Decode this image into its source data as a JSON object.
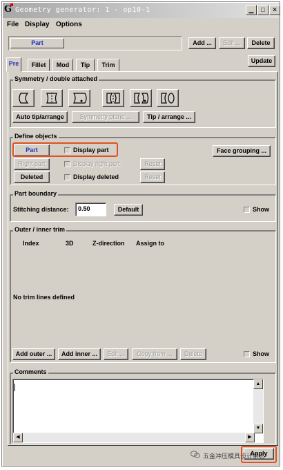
{
  "window": {
    "title": "Geometry generator: 1  -  op10-1"
  },
  "menubar": [
    "File",
    "Display",
    "Options"
  ],
  "part_bar": {
    "part_label": "Part",
    "add_label": "Add ...",
    "edit_label": "Edit ...",
    "delete_label": "Delete"
  },
  "tabs": [
    "Pre",
    "Fillet",
    "Mod",
    "Tip",
    "Trim"
  ],
  "update_label": "Update",
  "symmetry": {
    "title": "Symmetry / double attached",
    "auto_tip_label": "Auto tip/arrange",
    "symmetry_plane_label": "Symmetry plane ...",
    "tip_arrange_label": "Tip / arrange ..."
  },
  "define_objects": {
    "title": "Define objects",
    "part_label": "Part",
    "display_part_label": "Display part",
    "face_grouping_label": "Face grouping ...",
    "right_part_label": "Right part",
    "display_right_part_label": "Display right part",
    "reset1_label": "Reset",
    "deleted_label": "Deleted",
    "display_deleted_label": "Display deleted",
    "reset2_label": "Reset"
  },
  "part_boundary": {
    "title": "Part boundary",
    "stitching_label": "Stitching distance:",
    "stitching_value": "0.50",
    "default_label": "Default",
    "show_label": "Show"
  },
  "trim": {
    "title": "Outer / inner trim",
    "columns": [
      "Index",
      "3D",
      "Z-direction",
      "Assign to"
    ],
    "empty_text": "No trim lines defined",
    "add_outer_label": "Add outer ...",
    "add_inner_label": "Add inner ...",
    "edit_label": "Edit ...",
    "copy_from_label": "Copy from ...",
    "delete_label": "Delete",
    "show_label": "Show"
  },
  "comments": {
    "title": "Comments"
  },
  "apply_label": "Apply",
  "watermark": "五金冲压模具设计杂志",
  "colors": {
    "highlight": "#e05020",
    "panel": "#d4d0c8",
    "active_text": "#2030c0"
  }
}
